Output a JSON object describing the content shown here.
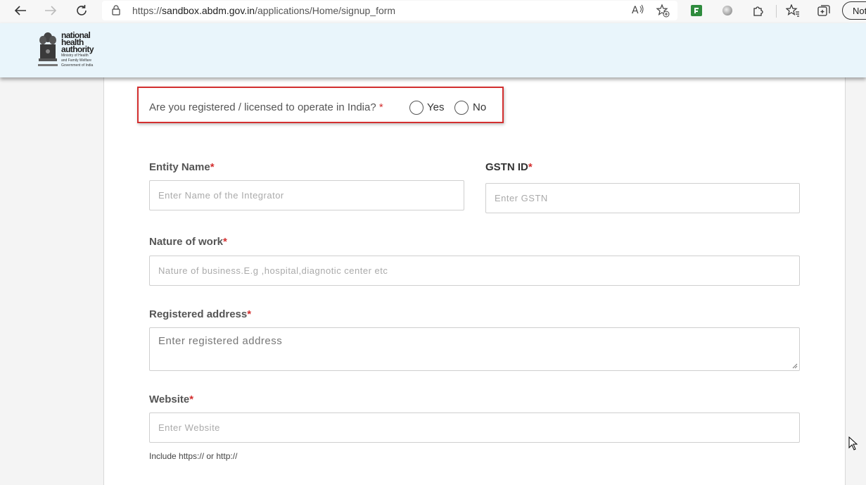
{
  "browser": {
    "url_prefix": "https://",
    "url_domain": "sandbox.abdm.gov.in",
    "url_path": "/applications/Home/signup_form",
    "profile_button_label": "Not"
  },
  "header": {
    "logo_lines": [
      "national",
      "health",
      "authority"
    ],
    "logo_sub_lines": [
      "Ministry of Health",
      "and Family Welfare",
      "Government of India"
    ]
  },
  "form": {
    "question": "Are you registered / licensed to operate in India?",
    "required_mark": "*",
    "radio_yes": "Yes",
    "radio_no": "No",
    "entity_name": {
      "label": "Entity Name",
      "placeholder": "Enter Name of the Integrator"
    },
    "gstn": {
      "label": "GSTN ID",
      "placeholder": "Enter GSTN"
    },
    "nature": {
      "label": "Nature of work",
      "placeholder": "Nature of business.E.g ,hospital,diagnotic center etc"
    },
    "address": {
      "label": "Registered address",
      "placeholder": "Enter registered address"
    },
    "website": {
      "label": "Website",
      "placeholder": "Enter Website",
      "hint": "Include https:// or http://"
    }
  },
  "colors": {
    "required": "#d32f2f",
    "header_bg": "#e9f5fb",
    "highlight_border": "#d32f2f"
  }
}
